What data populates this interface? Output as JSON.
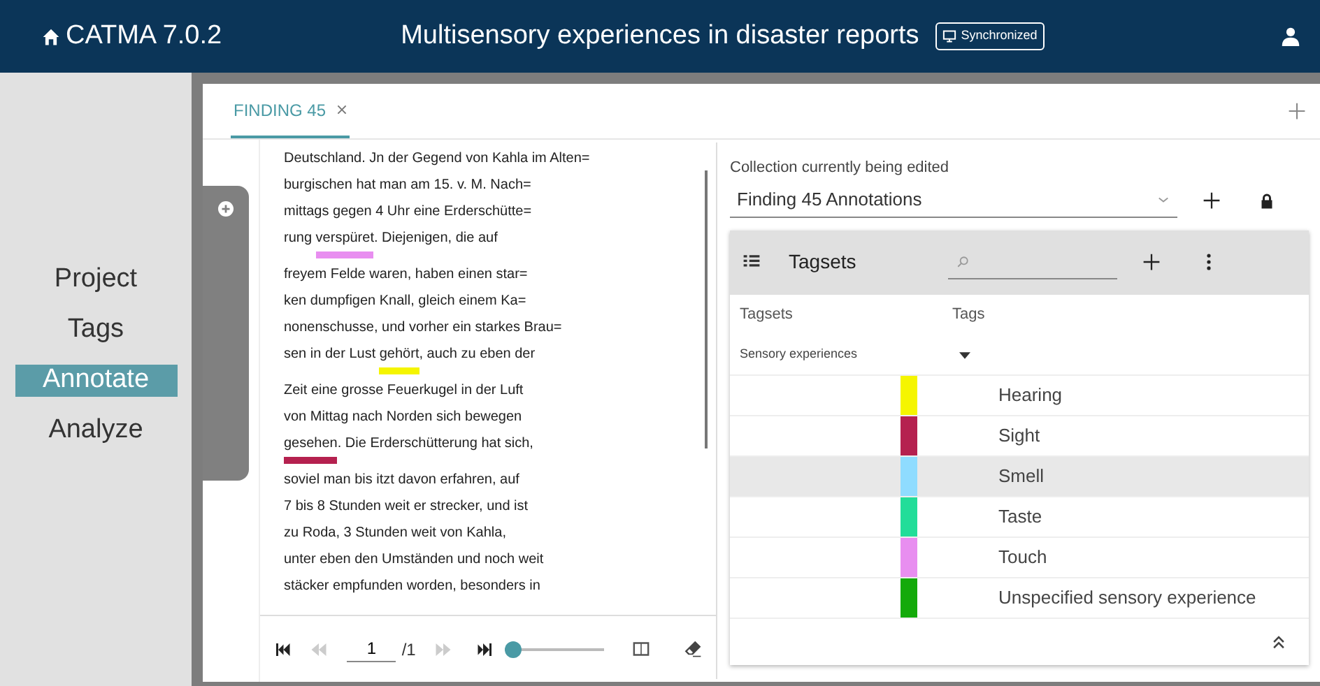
{
  "header": {
    "app": "CATMA 7.0.2",
    "title": "Multisensory experiences in disaster reports",
    "sync_badge": "Synchronized"
  },
  "nav": [
    {
      "label": "Project",
      "selected": false
    },
    {
      "label": "Tags",
      "selected": false
    },
    {
      "label": "Annotate",
      "selected": true
    },
    {
      "label": "Analyze",
      "selected": false
    }
  ],
  "tabs": [
    {
      "label": "FINDING 45",
      "selected": true
    }
  ],
  "document": {
    "lines": [
      {
        "segments": [
          {
            "text": "Deutschland. Jn der Gegend von Kahla im Alten="
          }
        ]
      },
      {
        "segments": [
          {
            "text": "burgischen hat man am 15. v. M. Nach="
          }
        ]
      },
      {
        "segments": [
          {
            "text": "mittags gegen 4 Uhr eine Erderschütte="
          }
        ]
      },
      {
        "segments": [
          {
            "text": "rung "
          },
          {
            "text": "verspüret",
            "color": "#e88ef0"
          },
          {
            "text": ". Diejenigen, die auf"
          }
        ]
      },
      {
        "segments": [
          {
            "text": "freyem Felde waren, haben einen star="
          }
        ]
      },
      {
        "segments": [
          {
            "text": "ken dumpfigen Knall, gleich einem Ka="
          }
        ]
      },
      {
        "segments": [
          {
            "text": "nonenschusse, und vorher ein starkes Brau="
          }
        ]
      },
      {
        "segments": [
          {
            "text": "sen in der Lust "
          },
          {
            "text": "gehört",
            "color": "#f5f500"
          },
          {
            "text": ", auch zu eben der"
          }
        ]
      },
      {
        "segments": [
          {
            "text": "Zeit eine grosse Feuerkugel in der Luft"
          }
        ]
      },
      {
        "segments": [
          {
            "text": "von Mittag nach Norden sich bewegen"
          }
        ]
      },
      {
        "segments": [
          {
            "text": "gesehen",
            "color": "#b5214f"
          },
          {
            "text": ". Die Erderschütterung hat sich,"
          }
        ]
      },
      {
        "segments": [
          {
            "text": "soviel man bis itzt davon erfahren, auf"
          }
        ]
      },
      {
        "segments": [
          {
            "text": "7 bis 8 Stunden weit er strecker, und ist"
          }
        ]
      },
      {
        "segments": [
          {
            "text": "zu Roda, 3 Stunden weit von Kahla,"
          }
        ]
      },
      {
        "segments": [
          {
            "text": "unter eben den Umständen und noch weit"
          }
        ]
      },
      {
        "segments": [
          {
            "text": "stäcker empfunden worden, besonders in"
          }
        ]
      }
    ]
  },
  "pager": {
    "page": "1",
    "total": "/1",
    "level": 0
  },
  "collection": {
    "label": "Collection currently being edited",
    "value": "Finding 45 Annotations"
  },
  "tagsets": {
    "title": "Tagsets",
    "col_tagsets": "Tagsets",
    "col_tags": "Tags",
    "tagset_name": "Sensory experiences",
    "tags": [
      {
        "label": "Hearing",
        "color": "#f5f500",
        "selected": false
      },
      {
        "label": "Sight",
        "color": "#b5214f",
        "selected": false
      },
      {
        "label": "Smell",
        "color": "#8fdcff",
        "selected": true
      },
      {
        "label": "Taste",
        "color": "#22dd99",
        "selected": false
      },
      {
        "label": "Touch",
        "color": "#e88ef0",
        "selected": false
      },
      {
        "label": "Unspecified sensory experience",
        "color": "#14aa0a",
        "selected": false
      }
    ]
  }
}
